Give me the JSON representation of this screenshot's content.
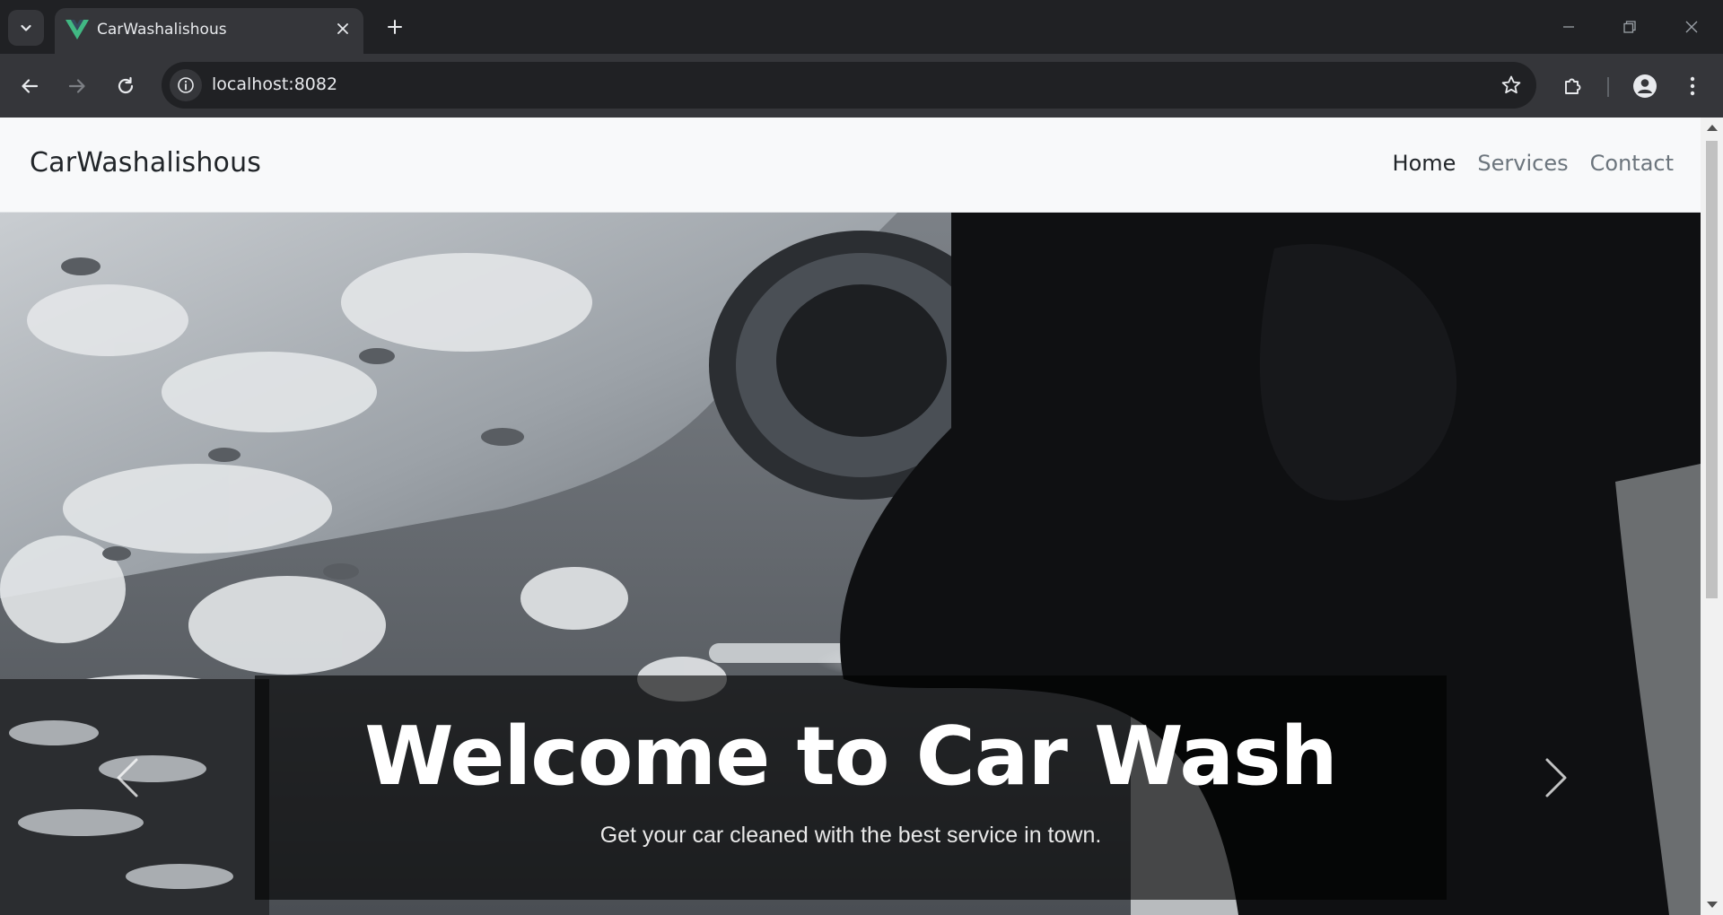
{
  "browser": {
    "tab_title": "CarWashalishous",
    "url": "localhost:8082",
    "colors": {
      "frame": "#202124",
      "toolbar": "#35363a",
      "vue_green": "#41b883"
    }
  },
  "icons": {
    "tab_list": "chevron-down-icon",
    "favicon": "vue-logo-icon",
    "tab_close": "close-icon",
    "new_tab": "plus-icon",
    "minimize": "minimize-icon",
    "restore": "restore-icon",
    "close_window": "close-icon",
    "back": "arrow-left-icon",
    "forward": "arrow-right-icon",
    "reload": "reload-icon",
    "site_info": "info-icon",
    "bookmark": "star-icon",
    "extensions": "puzzle-icon",
    "profile": "person-icon",
    "menu": "more-vertical-icon",
    "carousel_prev": "chevron-left-icon",
    "carousel_next": "chevron-right-icon"
  },
  "navbar": {
    "brand": "CarWashalishous",
    "links": [
      {
        "label": "Home",
        "active": true
      },
      {
        "label": "Services",
        "active": false
      },
      {
        "label": "Contact",
        "active": false
      }
    ]
  },
  "hero": {
    "title": "Welcome to Car Wash",
    "subtitle": "Get your car cleaned with the best service in town."
  }
}
